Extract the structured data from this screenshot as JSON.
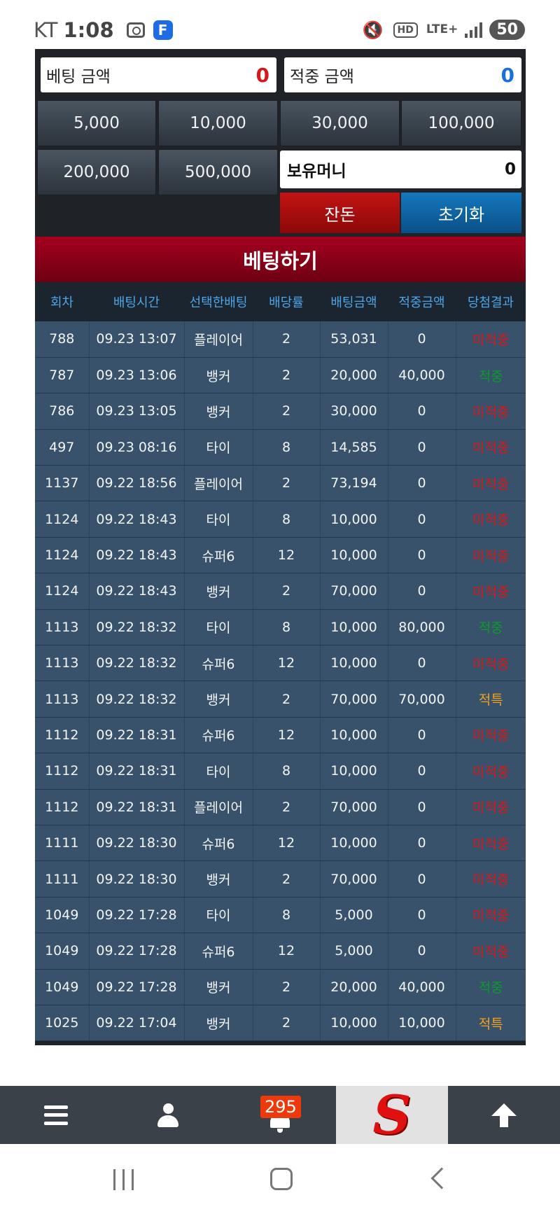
{
  "status_bar": {
    "carrier": "KT",
    "time": "1:08",
    "network": "LTE+",
    "battery": "50"
  },
  "top": {
    "bet_amount_label": "베팅 금액",
    "bet_amount_value": "0",
    "win_amount_label": "적중 금액",
    "win_amount_value": "0",
    "chips": [
      "5,000",
      "10,000",
      "30,000",
      "100,000",
      "200,000",
      "500,000"
    ],
    "money_label": "보유머니",
    "money_value": "0",
    "change_label": "잔돈",
    "reset_label": "초기화",
    "colors": {
      "bet_value": "#d81818",
      "win_value": "#1a6fd8"
    }
  },
  "bet_title": "베팅하기",
  "table": {
    "headers": [
      "회차",
      "배팅시간",
      "선택한배팅",
      "배당률",
      "배팅금액",
      "적중금액",
      "당첨결과"
    ],
    "rows": [
      [
        "788",
        "09.23 13:07",
        "플레이어",
        "2",
        "53,031",
        "0",
        "미적중"
      ],
      [
        "787",
        "09.23 13:06",
        "뱅커",
        "2",
        "20,000",
        "40,000",
        "적중"
      ],
      [
        "786",
        "09.23 13:05",
        "뱅커",
        "2",
        "30,000",
        "0",
        "미적중"
      ],
      [
        "497",
        "09.23 08:16",
        "타이",
        "8",
        "14,585",
        "0",
        "미적중"
      ],
      [
        "1137",
        "09.22 18:56",
        "플레이어",
        "2",
        "73,194",
        "0",
        "미적중"
      ],
      [
        "1124",
        "09.22 18:43",
        "타이",
        "8",
        "10,000",
        "0",
        "미적중"
      ],
      [
        "1124",
        "09.22 18:43",
        "슈퍼6",
        "12",
        "10,000",
        "0",
        "미적중"
      ],
      [
        "1124",
        "09.22 18:43",
        "뱅커",
        "2",
        "70,000",
        "0",
        "미적중"
      ],
      [
        "1113",
        "09.22 18:32",
        "타이",
        "8",
        "10,000",
        "80,000",
        "적중"
      ],
      [
        "1113",
        "09.22 18:32",
        "슈퍼6",
        "12",
        "10,000",
        "0",
        "미적중"
      ],
      [
        "1113",
        "09.22 18:32",
        "뱅커",
        "2",
        "70,000",
        "70,000",
        "적특"
      ],
      [
        "1112",
        "09.22 18:31",
        "슈퍼6",
        "12",
        "10,000",
        "0",
        "미적중"
      ],
      [
        "1112",
        "09.22 18:31",
        "타이",
        "8",
        "10,000",
        "0",
        "미적중"
      ],
      [
        "1112",
        "09.22 18:31",
        "플레이어",
        "2",
        "70,000",
        "0",
        "미적중"
      ],
      [
        "1111",
        "09.22 18:30",
        "슈퍼6",
        "12",
        "10,000",
        "0",
        "미적중"
      ],
      [
        "1111",
        "09.22 18:30",
        "뱅커",
        "2",
        "70,000",
        "0",
        "미적중"
      ],
      [
        "1049",
        "09.22 17:28",
        "타이",
        "8",
        "5,000",
        "0",
        "미적중"
      ],
      [
        "1049",
        "09.22 17:28",
        "슈퍼6",
        "12",
        "5,000",
        "0",
        "미적중"
      ],
      [
        "1049",
        "09.22 17:28",
        "뱅커",
        "2",
        "20,000",
        "40,000",
        "적중"
      ],
      [
        "1025",
        "09.22 17:04",
        "뱅커",
        "2",
        "10,000",
        "10,000",
        "적특"
      ]
    ]
  },
  "bottom_nav": {
    "items": [
      "menu-icon",
      "user-icon",
      "bell-icon",
      "logo",
      "arrow-up-icon"
    ],
    "notification_count": "295",
    "logo_letter": "S"
  }
}
